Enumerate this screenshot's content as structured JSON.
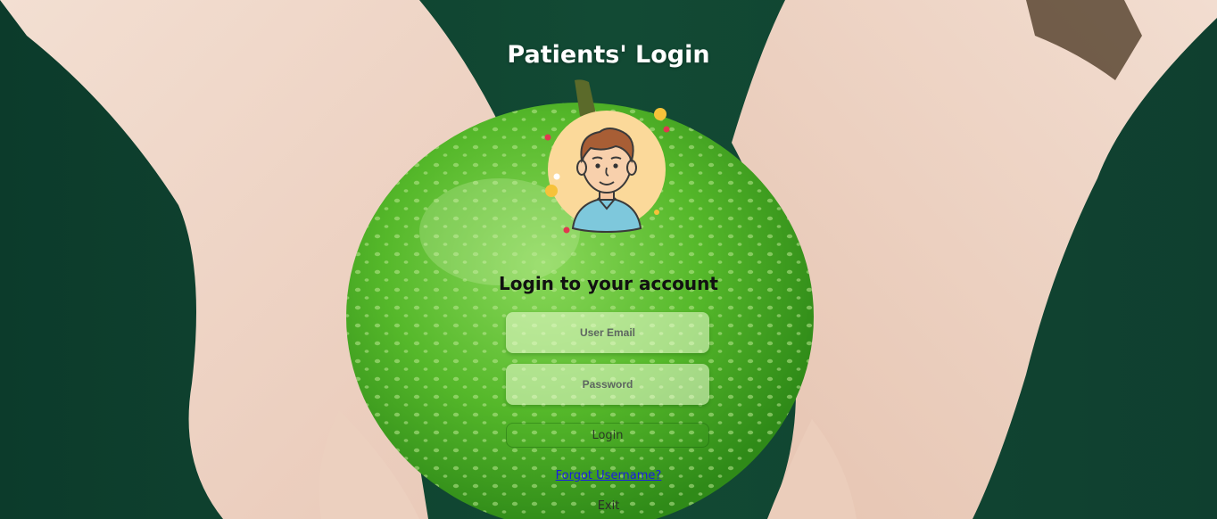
{
  "page": {
    "title": "Patients' Login"
  },
  "avatar": {
    "icon": "user-avatar-icon"
  },
  "login_form": {
    "heading": "Login to your account",
    "email_placeholder": "User Email",
    "password_placeholder": "Password",
    "login_label": "Login",
    "forgot_label": "Forgot Username?",
    "exit_label": "Exit"
  },
  "colors": {
    "apple_green": "#5fbf2a",
    "field_bg": "#e6f5d2",
    "link_blue": "#1a1ae6",
    "title_white": "#ffffff"
  }
}
